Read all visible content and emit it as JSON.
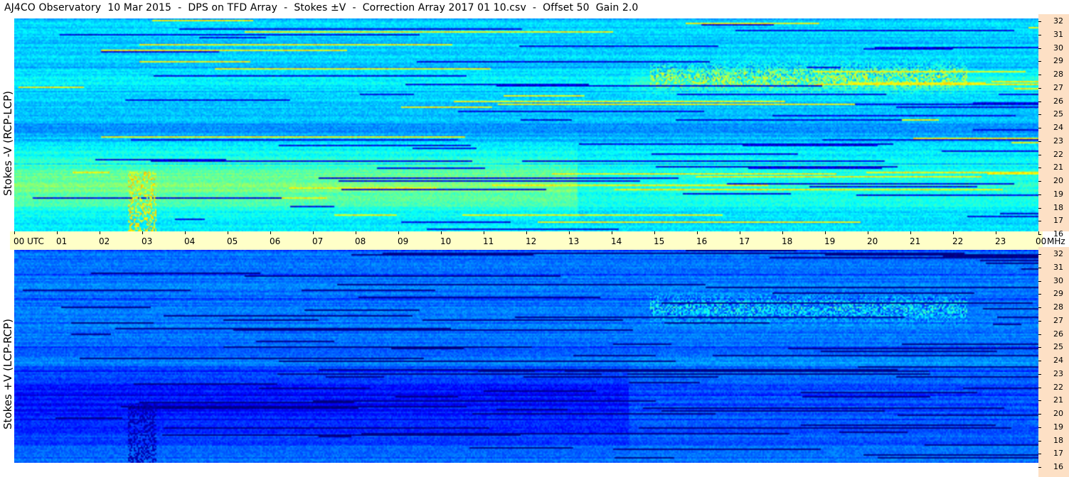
{
  "title": "AJ4CO Observatory  10 Mar 2015  -  DPS on TFD Array  -  Stokes ±V  -  Correction Array 2017 01 10.csv  -  Offset 50  Gain 2.0",
  "colors": {
    "time_axis_bg": "#ffffc8",
    "freq_axis_bg": "#fde0c5"
  },
  "chart_data": [
    {
      "type": "heatmap",
      "ylabel": "Stokes -V (RCP-LCP)",
      "x_ticks": [
        "00 UTC",
        "01",
        "02",
        "03",
        "04",
        "05",
        "06",
        "07",
        "08",
        "09",
        "10",
        "11",
        "12",
        "13",
        "14",
        "15",
        "16",
        "17",
        "18",
        "19",
        "20",
        "21",
        "22",
        "23",
        "00"
      ],
      "x_range_hours": [
        0,
        24
      ],
      "y_unit": "MHz",
      "y_ticks": [
        "32",
        "31",
        "30",
        "29",
        "28",
        "27",
        "26",
        "25",
        "24",
        "23",
        "22",
        "21",
        "20",
        "19",
        "18",
        "17",
        "16"
      ],
      "y_range_mhz": [
        16,
        32
      ],
      "colormap": "jet"
    },
    {
      "type": "heatmap",
      "ylabel": "Stokes +V (LCP-RCP)",
      "x_range_hours": [
        0,
        24
      ],
      "y_ticks": [
        "32",
        "31",
        "30",
        "29",
        "28",
        "27",
        "26",
        "25",
        "24",
        "23",
        "22",
        "21",
        "20",
        "19",
        "18",
        "17",
        "16"
      ],
      "y_range_mhz": [
        16,
        32
      ],
      "colormap": "jet"
    }
  ]
}
